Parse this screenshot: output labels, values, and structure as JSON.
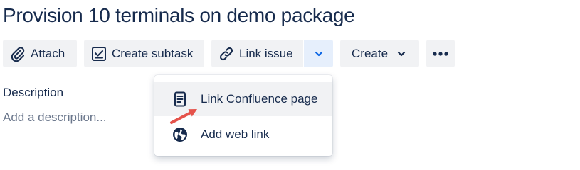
{
  "issue": {
    "title": "Provision 10 terminals on demo package"
  },
  "toolbar": {
    "attach_label": "Attach",
    "attach_icon": "paperclip-icon",
    "create_subtask_label": "Create subtask",
    "create_subtask_icon": "subtask-icon",
    "link_issue_label": "Link issue",
    "link_issue_icon": "link-icon",
    "link_dropdown_icon": "chevron-down-icon",
    "create_label": "Create",
    "create_icon": "chevron-down-icon",
    "more_icon": "more-horizontal-icon"
  },
  "description": {
    "label": "Description",
    "placeholder": "Add a description..."
  },
  "link_menu": {
    "items": [
      {
        "label": "Link Confluence page",
        "icon": "confluence-page-icon",
        "highlighted": true
      },
      {
        "label": "Add web link",
        "icon": "globe-icon",
        "highlighted": false
      }
    ]
  },
  "annotation": {
    "arrow_color": "#e5534b",
    "arrow_target": "Link Confluence page"
  },
  "colors": {
    "text": "#172b4d",
    "button_bg": "#f1f2f4",
    "active_dropdown_bg": "#e6effc",
    "accent": "#0c66e4",
    "placeholder": "#6b778c"
  }
}
